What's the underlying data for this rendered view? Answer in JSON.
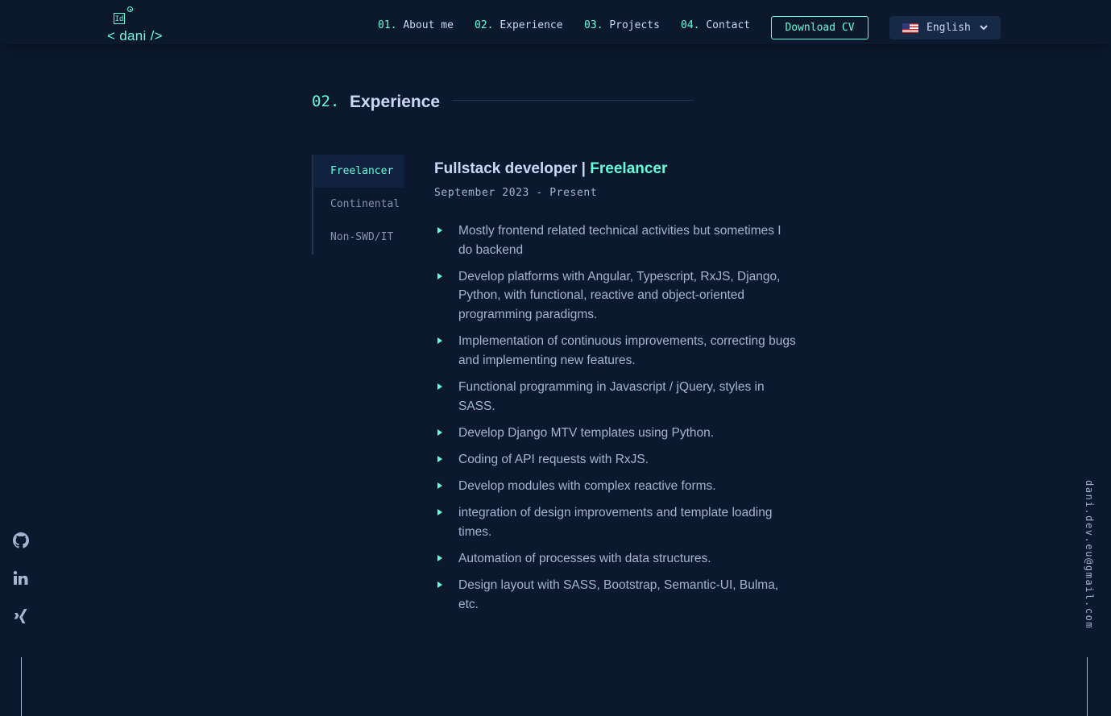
{
  "logo": {
    "badge": "Id",
    "text": "< dani />"
  },
  "nav": {
    "items": [
      {
        "num": "01.",
        "label": "About me"
      },
      {
        "num": "02.",
        "label": "Experience"
      },
      {
        "num": "03.",
        "label": "Projects"
      },
      {
        "num": "04.",
        "label": "Contact"
      }
    ],
    "download_cv": "Download CV",
    "language": "English"
  },
  "section": {
    "num": "02.",
    "title": "Experience"
  },
  "tabs": [
    {
      "label": "Freelancer",
      "active": true
    },
    {
      "label": "Continental",
      "active": false
    },
    {
      "label": "Non-SWD/IT",
      "active": false
    }
  ],
  "job": {
    "title": "Fullstack developer",
    "separator": " | ",
    "company": "Freelancer",
    "date": "September 2023 - Present",
    "bullets": [
      "Mostly frontend related technical activities but sometimes I do backend",
      "Develop platforms with Angular, Typescript, RxJS, Django, Python, with functional, reactive and object-oriented programming paradigms.",
      "Implementation of continuous improvements, correcting bugs and implementing new features.",
      "Functional programming in Javascript / jQuery, styles in SASS.",
      "Develop Django MTV templates using Python.",
      "Coding of API requests with RxJS.",
      "Develop modules with complex reactive forms.",
      "integration of design improvements and template loading times.",
      "Automation of processes with data structures.",
      "Design layout with SASS, Bootstrap, Semantic-UI, Bulma, etc."
    ]
  },
  "social": [
    "github-icon",
    "linkedin-icon",
    "xing-icon"
  ],
  "email": "dani.dev.eu@gmail.com",
  "colors": {
    "background": "#0b182d",
    "accent": "#64ffda",
    "heading": "#ccd6f6",
    "text": "#a8b2d1"
  }
}
